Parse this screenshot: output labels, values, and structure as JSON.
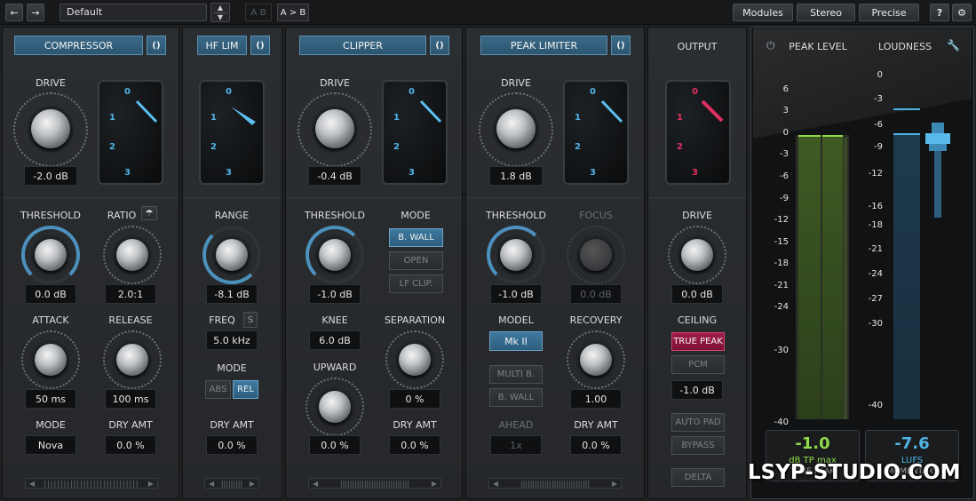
{
  "topbar": {
    "back_icon": "arrow-left-icon",
    "forward_icon": "arrow-right-icon",
    "preset": "Default",
    "ab_label": "A B",
    "ab_copy": "A > B",
    "modules": "Modules",
    "stereo": "Stereo",
    "precise": "Precise",
    "help": "?",
    "settings_icon": "gear-icon"
  },
  "compressor": {
    "title": "COMPRESSOR",
    "link": "()",
    "drive_label": "DRIVE",
    "drive_value": "-2.0 dB",
    "meter_ticks": [
      "0",
      "1",
      "2",
      "3"
    ],
    "threshold_label": "THRESHOLD",
    "threshold_value": "0.0 dB",
    "ratio_label": "RATIO",
    "ratio_value": "2.0:1",
    "attack_label": "ATTACK",
    "attack_value": "50 ms",
    "release_label": "RELEASE",
    "release_value": "100 ms",
    "mode_label": "MODE",
    "mode_value": "Nova",
    "dry_label": "DRY AMT",
    "dry_value": "0.0 %"
  },
  "hflim": {
    "title": "HF LIM",
    "link": "()",
    "meter_ticks": [
      "0",
      "1",
      "2",
      "3"
    ],
    "range_label": "RANGE",
    "range_value": "-8.1 dB",
    "freq_label": "FREQ",
    "solo": "S",
    "freq_value": "5.0 kHz",
    "mode_label": "MODE",
    "abs": "ABS",
    "rel": "REL",
    "dry_label": "DRY AMT",
    "dry_value": "0.0 %"
  },
  "clipper": {
    "title": "CLIPPER",
    "link": "()",
    "drive_label": "DRIVE",
    "drive_value": "-0.4 dB",
    "meter_ticks": [
      "0",
      "1",
      "2",
      "3"
    ],
    "threshold_label": "THRESHOLD",
    "threshold_value": "-1.0 dB",
    "mode_label": "MODE",
    "bwall": "B. WALL",
    "open": "OPEN",
    "lfclip": "LF CLIP.",
    "knee_label": "KNEE",
    "knee_value": "6.0 dB",
    "separation_label": "SEPARATION",
    "separation_value": "0 %",
    "upward_label": "UPWARD",
    "upward_value": "0.0 %",
    "dry_label": "DRY AMT",
    "dry_value": "0.0 %"
  },
  "peaklimiter": {
    "title": "PEAK LIMITER",
    "link": "()",
    "drive_label": "DRIVE",
    "drive_value": "1.8 dB",
    "meter_ticks": [
      "0",
      "1",
      "2",
      "3"
    ],
    "threshold_label": "THRESHOLD",
    "threshold_value": "-1.0 dB",
    "focus_label": "FOCUS",
    "focus_value": "0.0 dB",
    "model_label": "MODEL",
    "model_value": "Mk II",
    "recovery_label": "RECOVERY",
    "recovery_value": "1.00",
    "multib": "MULTI B.",
    "bwall": "B. WALL",
    "ahead_label": "AHEAD",
    "ahead_value": "1x",
    "dry_label": "DRY AMT",
    "dry_value": "0.0 %"
  },
  "output": {
    "title": "OUTPUT",
    "meter_ticks": [
      "0",
      "1",
      "2",
      "3"
    ],
    "drive_label": "DRIVE",
    "drive_value": "0.0 dB",
    "ceiling_label": "CEILING",
    "truepeak": "TRUE PEAK",
    "pcm": "PCM",
    "ceiling_value": "-1.0 dB",
    "autopad": "AUTO PAD",
    "bypass": "BYPASS",
    "delta": "DELTA"
  },
  "meters": {
    "power_icon": "power-icon",
    "peak_title": "PEAK LEVEL",
    "loud_title": "LOUDNESS",
    "wrench_icon": "wrench-icon",
    "peak_scale": [
      "6",
      "3",
      "0",
      "-3",
      "-6",
      "-9",
      "-12",
      "-15",
      "-18",
      "-21",
      "-24",
      "-30",
      "-40"
    ],
    "loud_scale": [
      "0",
      "-3",
      "-6",
      "-9",
      "-12",
      "-16",
      "-18",
      "-21",
      "-24",
      "-27",
      "-30",
      "-40"
    ],
    "peak_value": "-1.0",
    "peak_unit": "dB TP max",
    "peak_sub": "TRUE PEAK",
    "loud_value": "-7.6",
    "loud_unit": "LUFS",
    "loud_sub": "MOMENTARY",
    "peak_color": "#8fd94a",
    "loud_color": "#4fb3e6"
  },
  "watermark": "LSYP-STUDIO.COM"
}
